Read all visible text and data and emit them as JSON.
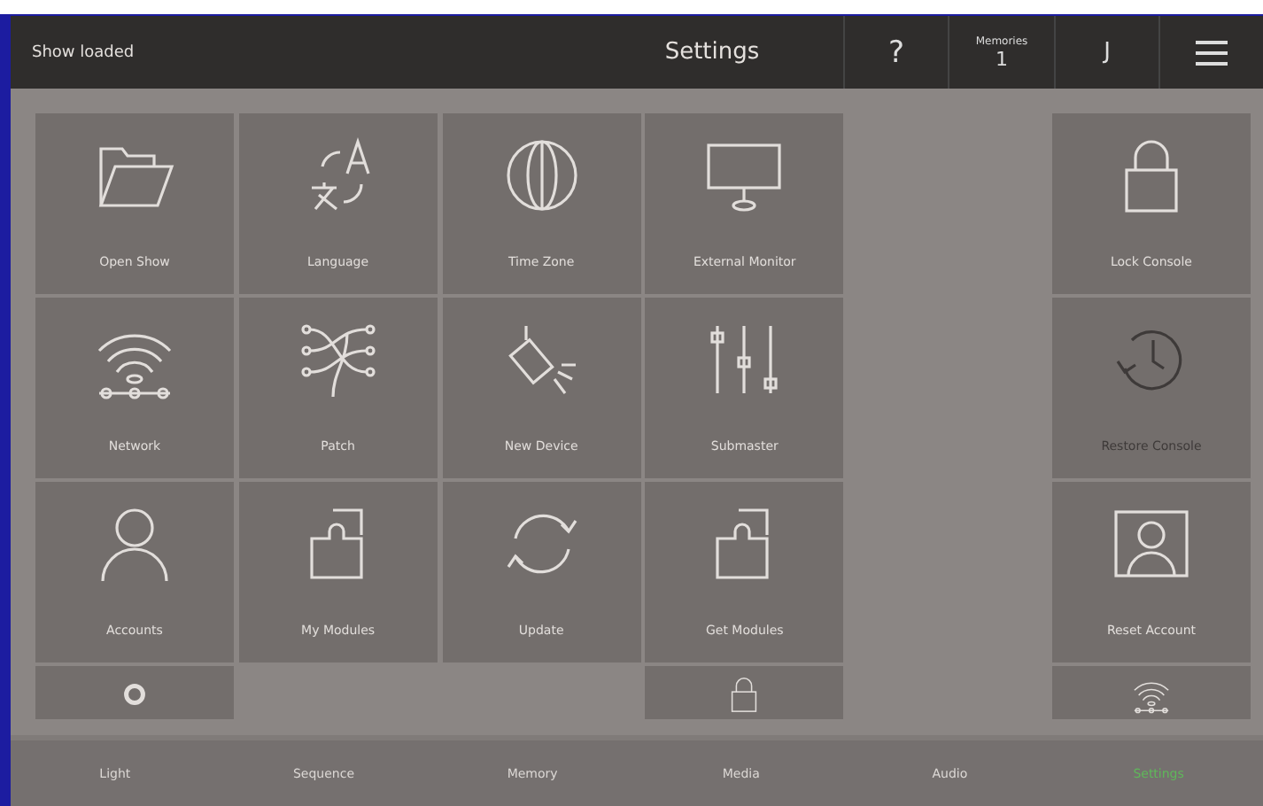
{
  "top_bar": {
    "status": "Show loaded",
    "title": "Settings",
    "help": "?",
    "memories": {
      "label": "Memories",
      "value": "1"
    },
    "user": "J"
  },
  "tiles": [
    {
      "kind": "tile",
      "label": "Open Show",
      "disabled": false
    },
    {
      "kind": "tile",
      "label": "Language",
      "disabled": false
    },
    {
      "kind": "tile",
      "label": "Time Zone",
      "disabled": false
    },
    {
      "kind": "tile",
      "label": "External Monitor",
      "disabled": false
    },
    {
      "kind": "empty"
    },
    {
      "kind": "tile",
      "label": "Lock Console",
      "disabled": false
    },
    {
      "kind": "tile",
      "label": "Network",
      "disabled": false
    },
    {
      "kind": "tile",
      "label": "Patch",
      "disabled": false
    },
    {
      "kind": "tile",
      "label": "New Device",
      "disabled": false
    },
    {
      "kind": "tile",
      "label": "Submaster",
      "disabled": false
    },
    {
      "kind": "empty"
    },
    {
      "kind": "tile",
      "label": "Restore Console",
      "disabled": true
    },
    {
      "kind": "tile",
      "label": "Accounts",
      "disabled": false
    },
    {
      "kind": "tile",
      "label": "My Modules",
      "disabled": false
    },
    {
      "kind": "tile",
      "label": "Update",
      "disabled": false
    },
    {
      "kind": "tile",
      "label": "Get Modules",
      "disabled": false
    },
    {
      "kind": "empty"
    },
    {
      "kind": "tile",
      "label": "Reset Account",
      "disabled": false
    },
    {
      "kind": "partial",
      "disabled": false
    },
    {
      "kind": "empty"
    },
    {
      "kind": "empty"
    },
    {
      "kind": "partial",
      "disabled": false
    },
    {
      "kind": "empty"
    },
    {
      "kind": "partial",
      "disabled": false
    }
  ],
  "nav": [
    {
      "label": "Light",
      "selected": false
    },
    {
      "label": "Sequence",
      "selected": false
    },
    {
      "label": "Memory",
      "selected": false
    },
    {
      "label": "Media",
      "selected": false
    },
    {
      "label": "Audio",
      "selected": false
    },
    {
      "label": "Settings",
      "selected": true
    }
  ]
}
